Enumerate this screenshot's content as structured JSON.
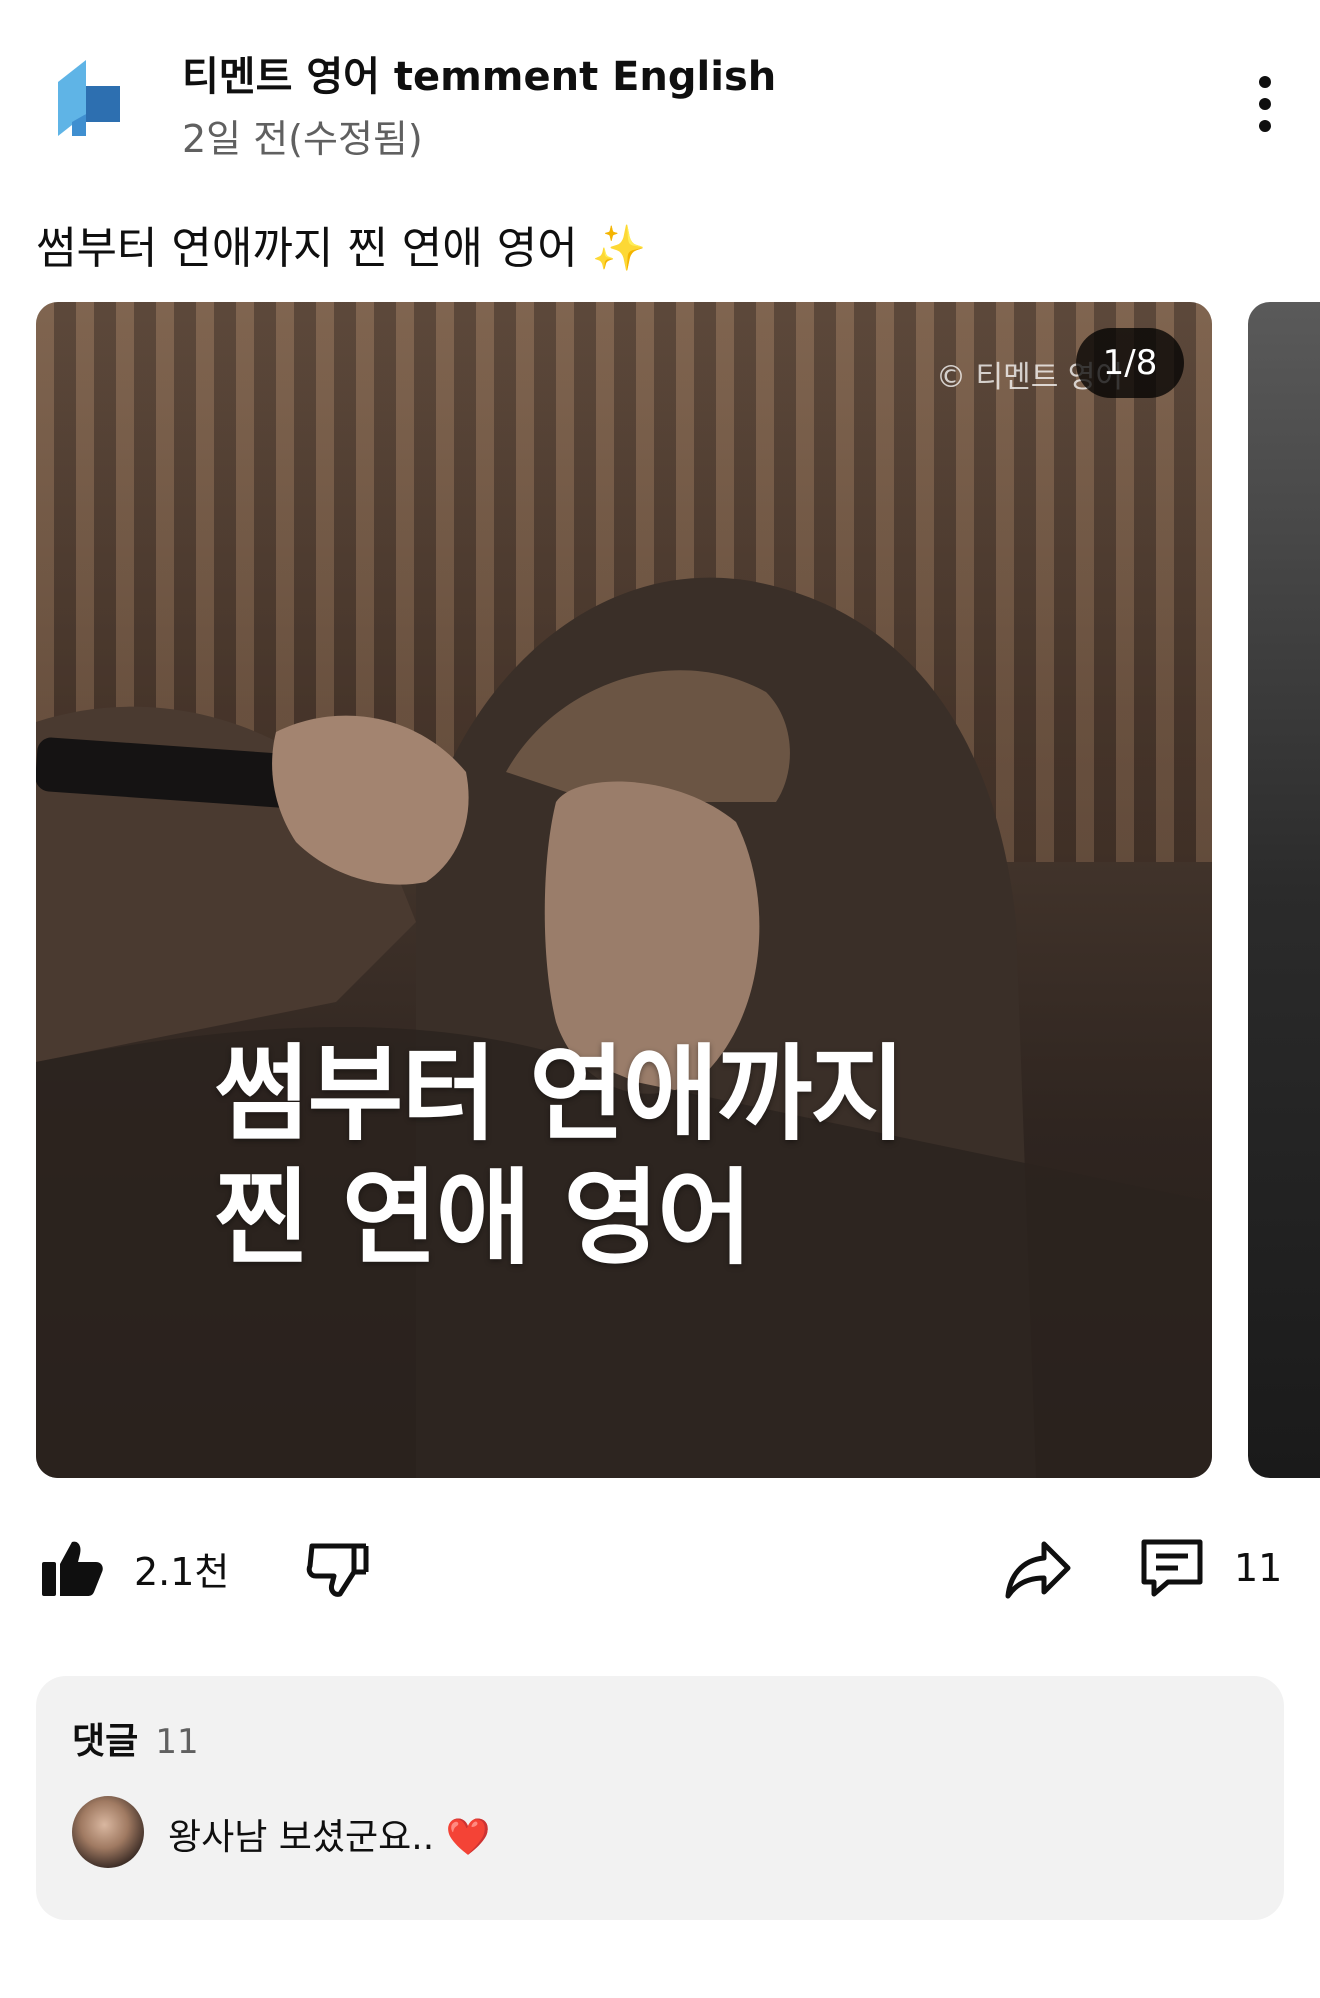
{
  "channel": {
    "name": "티멘트 영어 temment English",
    "time": "2일 전(수정됨)"
  },
  "post": {
    "text": "썸부터 연애까지 찐 연애 영어",
    "sparkles": "✨"
  },
  "carousel": {
    "counter": "1/8",
    "watermark": "© 티멘트 영어",
    "overlay_line1": "썸부터 연애까지",
    "overlay_line2": "찐 연애 영어"
  },
  "actions": {
    "like_count": "2.1천",
    "comment_count": "11",
    "like_icon": "thumbs-up-icon",
    "dislike_icon": "thumbs-down-icon",
    "share_icon": "share-icon",
    "comment_icon": "comment-icon"
  },
  "comments": {
    "title": "댓글",
    "count": "11",
    "top_comment": "왕사남 보셨군요..",
    "heart": "❤️"
  },
  "colors": {
    "logo_light": "#5fb4e6",
    "logo_dark": "#2d6fb0",
    "comments_bg": "#f2f2f2",
    "secondary_text": "#606060"
  }
}
